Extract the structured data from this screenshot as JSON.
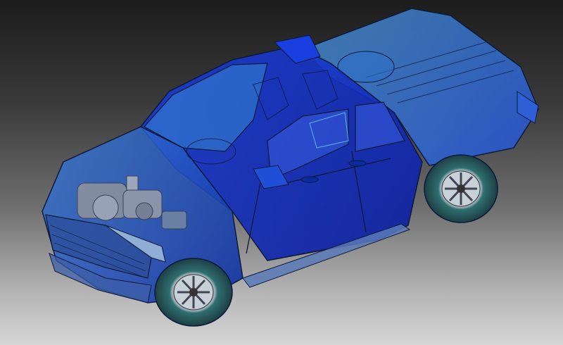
{
  "scene": {
    "subject": "pickup truck",
    "render_style": "transparent blue x-ray CAD render",
    "colors": {
      "background_top": "#1c1c1c",
      "background_bottom": "#d6d6d6",
      "body_blue": "#1f4fd6",
      "body_blue_dark": "#0b2a9e",
      "glass_cyan": "#48b6e0",
      "panel_lines": "#0a1a3a",
      "tire": "#2a5a5a",
      "rim": "#9fb0b8",
      "engine_grey": "#9a9a9a"
    },
    "icons": [
      "truck-icon"
    ]
  }
}
